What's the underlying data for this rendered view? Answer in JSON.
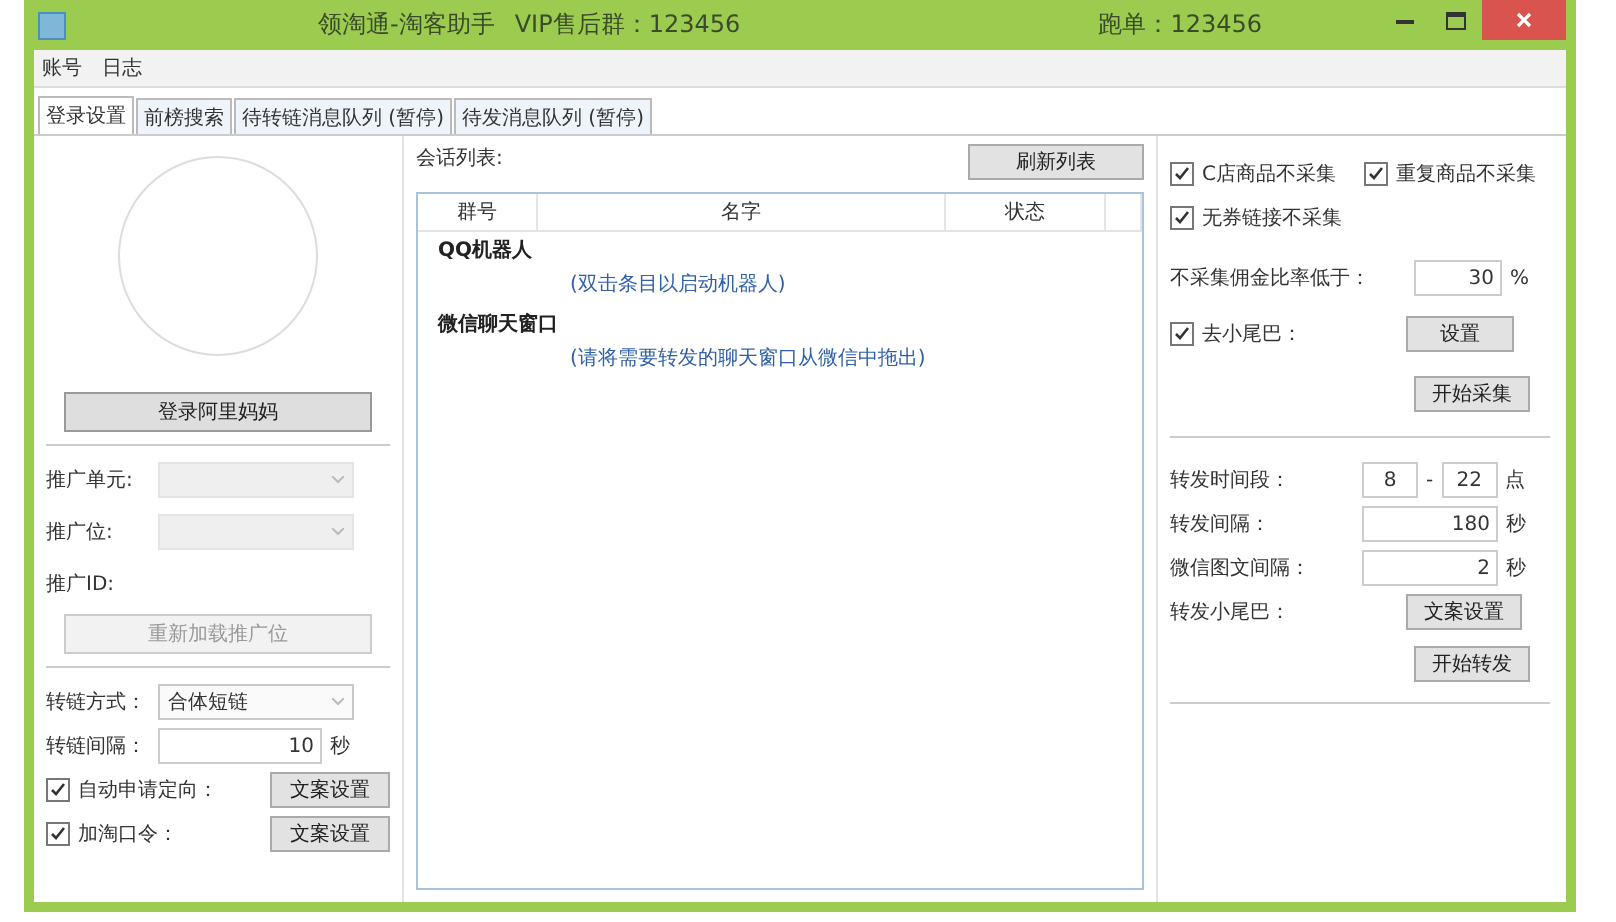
{
  "window": {
    "title": "领淘通-淘客助手",
    "vip": "VIP售后群：123456",
    "orders": "跑单：123456"
  },
  "menu": [
    "账号",
    "日志"
  ],
  "tabs": [
    {
      "label": "登录设置",
      "selected": true
    },
    {
      "label": "前榜搜索",
      "selected": false
    },
    {
      "label": "待转链消息队列 (暂停)",
      "selected": false
    },
    {
      "label": "待发消息队列 (暂停)",
      "selected": false
    }
  ],
  "login": {
    "button": "登录阿里妈妈"
  },
  "promo": {
    "fields": [
      {
        "label": "推广单元:",
        "disabled": true
      },
      {
        "label": "推广位:",
        "disabled": true
      }
    ],
    "id_label": "推广ID:",
    "reload": {
      "label": "重新加载推广位",
      "disabled": true
    }
  },
  "link": {
    "mode_label": "转链方式：",
    "mode_value": "合体短链",
    "interval_label": "转链间隔：",
    "interval_value": "10",
    "interval_unit": "秒",
    "options": [
      {
        "label": "自动申请定向：",
        "checked": true,
        "button": "文案设置"
      },
      {
        "label": "加淘口令：",
        "checked": true,
        "button": "文案设置"
      }
    ]
  },
  "sessions": {
    "label": "会话列表:",
    "refresh": "刷新列表",
    "columns": [
      "群号",
      "名字",
      "状态"
    ],
    "groups": [
      {
        "title": "QQ机器人",
        "hint": "(双击条目以启动机器人)"
      },
      {
        "title": "微信聊天窗口",
        "hint": "(请将需要转发的聊天窗口从微信中拖出)"
      }
    ]
  },
  "collect": {
    "options": [
      {
        "label": "C店商品不采集",
        "checked": true
      },
      {
        "label": "重复商品不采集",
        "checked": true
      },
      {
        "label": "无券链接不采集",
        "checked": true
      }
    ],
    "rate_label": "不采集佣金比率低于：",
    "rate_value": "30",
    "rate_unit": "%",
    "tail": {
      "label": "去小尾巴：",
      "checked": true,
      "button": "设置"
    },
    "start": "开始采集"
  },
  "forward": {
    "time_label": "转发时间段：",
    "time_from": "8",
    "time_sep": "-",
    "time_to": "22",
    "time_unit": "点",
    "interval_label": "转发间隔：",
    "interval_value": "180",
    "interval_unit": "秒",
    "wechat_label": "微信图文间隔：",
    "wechat_value": "2",
    "wechat_unit": "秒",
    "tail_label": "转发小尾巴：",
    "tail_button": "文案设置",
    "start": "开始转发"
  }
}
